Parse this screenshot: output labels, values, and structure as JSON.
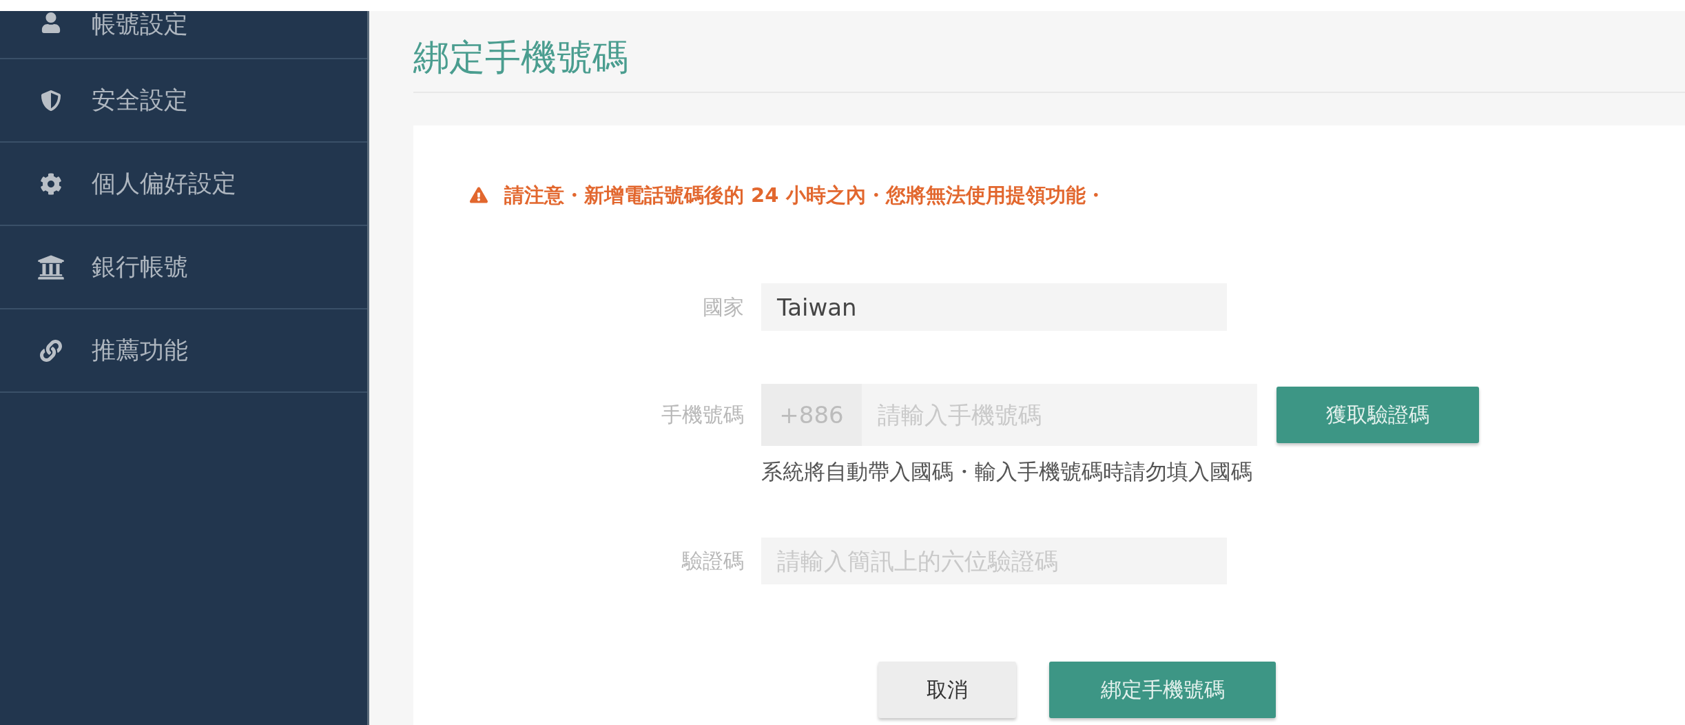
{
  "sidebar": {
    "items": [
      {
        "label": "帳號設定"
      },
      {
        "label": "安全設定"
      },
      {
        "label": "個人偏好設定"
      },
      {
        "label": "銀行帳號"
      },
      {
        "label": "推薦功能"
      }
    ]
  },
  "page": {
    "title": "綁定手機號碼"
  },
  "warning": "請注意・新增電話號碼後的 24 小時之內・您將無法使用提領功能・",
  "form": {
    "country": {
      "label": "國家",
      "value": "Taiwan"
    },
    "phone": {
      "label": "手機號碼",
      "prefix": "+886",
      "placeholder": "請輸入手機號碼",
      "button": "獲取驗證碼",
      "hint": "系統將自動帶入國碼・輸入手機號碼時請勿填入國碼"
    },
    "code": {
      "label": "驗證碼",
      "placeholder": "請輸入簡訊上的六位驗證碼"
    }
  },
  "actions": [
    {
      "label": "取消",
      "kind": "secondary"
    },
    {
      "label": "綁定手機號碼",
      "kind": "primary"
    }
  ]
}
